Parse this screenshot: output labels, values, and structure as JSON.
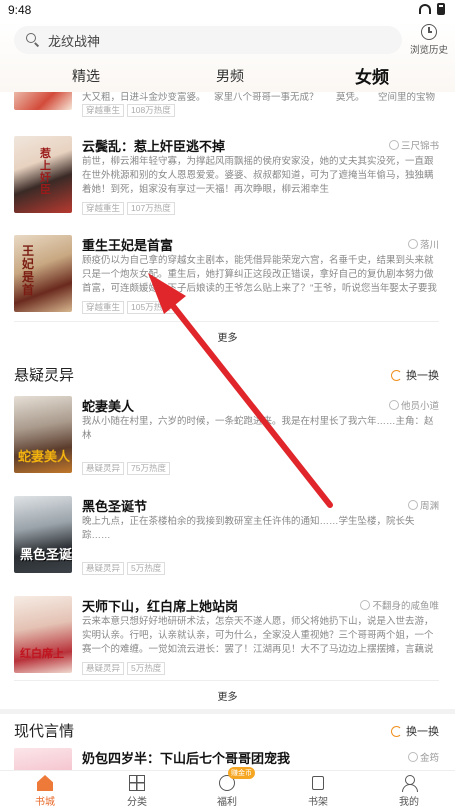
{
  "status": {
    "time": "9:48"
  },
  "search": {
    "query": "龙纹战神",
    "history_label": "浏览历史"
  },
  "tabs": [
    {
      "label": "精选"
    },
    {
      "label": "男频"
    },
    {
      "label": "女频"
    }
  ],
  "active_tab": "女频",
  "top_partial": {
    "titles": [
      "大又粗，日进斗金炒变富婆。",
      "家里八个哥哥一事无成？",
      "莫凭。",
      "空间里的宝物"
    ],
    "tag": "穿越重生",
    "heat": "108万热度"
  },
  "books_section1": [
    {
      "title": "云鬓乱：惹上奸臣逃不掉",
      "author": "三尺锦书",
      "desc": "前世，柳云湘年轻守寡，为撑起风雨飘摇的侯府安家没，她的丈夫其实没死，一直跟在世外桃源和别的女人恩恩爱爱。婆婆、叔叔都知道，可为了遮掩当年偷马，独独瞒着她！到死，姐家没有享过一天福！再次睁眼，柳云湘幸生",
      "tag": "穿越重生",
      "heat": "107万热度"
    },
    {
      "title": "重生王妃是首富",
      "author": "落川",
      "desc": "顾疫仍以为自己拿的穿越女主剧本，能凭借异能荣宠六宫，名垂千史，结果到头来就只是一个炮灰女配。重生后，她打算纠正这段改正错误，拿好自己的复仇剧本努力做首富，可连颇媛嫁一下子后娘读的王爷怎么贴上来了？\"王爷，听说您当年娶太子要我为佛教，",
      "tag": "穿越重生",
      "heat": "105万热度"
    }
  ],
  "more_label": "更多",
  "section2": {
    "title": "悬疑灵异",
    "refresh_label": "换一换",
    "books": [
      {
        "title": "蛇妻美人",
        "author": "他员小道",
        "desc": "我从小随在村里，六岁的时候，一条蛇跑进来。我是在村里长了我六年……主角：赵林",
        "tag": "悬疑灵异",
        "heat": "75万热度"
      },
      {
        "title": "黑色圣诞节",
        "author": "周渊",
        "desc": "晚上九点，正在茶楼柏余的我接到教研室主任许伟的通知……学生坠楼，院长失踪……",
        "tag": "悬疑灵异",
        "heat": "5万热度"
      },
      {
        "title": "天师下山，红白席上她站岗",
        "author": "不翻身的咸鱼唯",
        "desc": "云来本意只想好好地研研术法，怎奈天不遂人愿，师父将她扔下山，说是入世去游，实明认亲。行吧，认亲就认亲，可为什么，全家没人重视她？三个哥哥两个姐，一个赛一个的难缠。一觉如流云进长：罢了！江湖再见！大不了马边边上摆摆摊，言藕说里卜卜卦！",
        "tag": "悬疑灵异",
        "heat": "5万热度"
      }
    ]
  },
  "section3": {
    "title": "现代言情",
    "refresh_label": "换一换",
    "book": {
      "title": "奶包四岁半：下山后七个哥哥团宠我",
      "author": "金筠"
    }
  },
  "nav": {
    "items": [
      {
        "label": "书城"
      },
      {
        "label": "分类"
      },
      {
        "label": "福利"
      },
      {
        "label": "书架"
      },
      {
        "label": "我的"
      }
    ],
    "badge": "赚金币"
  },
  "colors": {
    "accent": "#e96a2a",
    "arrow": "#e0262b"
  }
}
